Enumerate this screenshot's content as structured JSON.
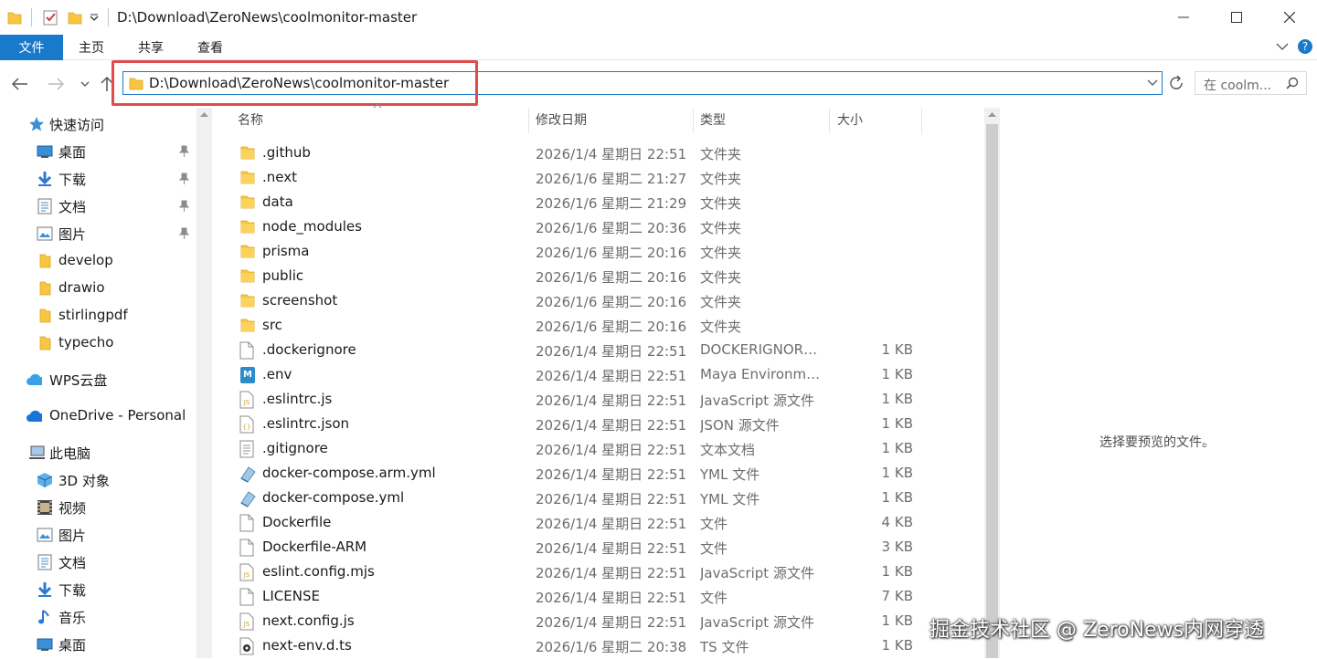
{
  "window": {
    "title": "D:\\Download\\ZeroNews\\coolmonitor-master",
    "minimize_label": "",
    "maximize_label": "",
    "close_label": ""
  },
  "ribbon": {
    "tabs": [
      "文件",
      "主页",
      "共享",
      "查看"
    ]
  },
  "address": {
    "path": "D:\\Download\\ZeroNews\\coolmonitor-master",
    "search_placeholder": "在 coolm..."
  },
  "sidebar": {
    "items": [
      {
        "label": "快速访问",
        "icon": "star-icon"
      },
      {
        "label": "桌面",
        "icon": "desktop-icon",
        "pinned": true
      },
      {
        "label": "下载",
        "icon": "download-icon",
        "pinned": true
      },
      {
        "label": "文档",
        "icon": "document-icon",
        "pinned": true
      },
      {
        "label": "图片",
        "icon": "picture-icon",
        "pinned": true
      },
      {
        "label": "develop",
        "icon": "folder-icon"
      },
      {
        "label": "drawio",
        "icon": "folder-icon"
      },
      {
        "label": "stirlingpdf",
        "icon": "folder-icon"
      },
      {
        "label": "typecho",
        "icon": "folder-icon"
      },
      {
        "label": "WPS云盘",
        "icon": "wps-cloud-icon"
      },
      {
        "label": "OneDrive - Personal",
        "icon": "onedrive-icon"
      },
      {
        "label": "此电脑",
        "icon": "computer-icon"
      },
      {
        "label": "3D 对象",
        "icon": "3d-objects-icon"
      },
      {
        "label": "视频",
        "icon": "video-icon"
      },
      {
        "label": "图片",
        "icon": "picture-icon"
      },
      {
        "label": "文档",
        "icon": "document-icon"
      },
      {
        "label": "下载",
        "icon": "download-icon"
      },
      {
        "label": "音乐",
        "icon": "music-icon"
      },
      {
        "label": "桌面",
        "icon": "desktop-icon"
      }
    ]
  },
  "columns": {
    "name": "名称",
    "date": "修改日期",
    "type": "类型",
    "size": "大小"
  },
  "files": [
    {
      "name": ".github",
      "date": "2026/1/4 星期日 22:51",
      "type": "文件夹",
      "size": "",
      "icon": "folder"
    },
    {
      "name": ".next",
      "date": "2026/1/6 星期二 21:27",
      "type": "文件夹",
      "size": "",
      "icon": "folder"
    },
    {
      "name": "data",
      "date": "2026/1/6 星期二 21:29",
      "type": "文件夹",
      "size": "",
      "icon": "folder"
    },
    {
      "name": "node_modules",
      "date": "2026/1/6 星期二 20:36",
      "type": "文件夹",
      "size": "",
      "icon": "folder"
    },
    {
      "name": "prisma",
      "date": "2026/1/6 星期二 20:16",
      "type": "文件夹",
      "size": "",
      "icon": "folder"
    },
    {
      "name": "public",
      "date": "2026/1/6 星期二 20:16",
      "type": "文件夹",
      "size": "",
      "icon": "folder"
    },
    {
      "name": "screenshot",
      "date": "2026/1/6 星期二 20:16",
      "type": "文件夹",
      "size": "",
      "icon": "folder"
    },
    {
      "name": "src",
      "date": "2026/1/6 星期二 20:16",
      "type": "文件夹",
      "size": "",
      "icon": "folder"
    },
    {
      "name": ".dockerignore",
      "date": "2026/1/4 星期日 22:51",
      "type": "DOCKERIGNORE...",
      "size": "1 KB",
      "icon": "file"
    },
    {
      "name": ".env",
      "date": "2026/1/4 星期日 22:51",
      "type": "Maya Environme...",
      "size": "1 KB",
      "icon": "maya"
    },
    {
      "name": ".eslintrc.js",
      "date": "2026/1/4 星期日 22:51",
      "type": "JavaScript 源文件",
      "size": "1 KB",
      "icon": "js"
    },
    {
      "name": ".eslintrc.json",
      "date": "2026/1/4 星期日 22:51",
      "type": "JSON 源文件",
      "size": "1 KB",
      "icon": "json"
    },
    {
      "name": ".gitignore",
      "date": "2026/1/4 星期日 22:51",
      "type": "文本文档",
      "size": "1 KB",
      "icon": "text"
    },
    {
      "name": "docker-compose.arm.yml",
      "date": "2026/1/4 星期日 22:51",
      "type": "YML 文件",
      "size": "1 KB",
      "icon": "yml"
    },
    {
      "name": "docker-compose.yml",
      "date": "2026/1/4 星期日 22:51",
      "type": "YML 文件",
      "size": "1 KB",
      "icon": "yml"
    },
    {
      "name": "Dockerfile",
      "date": "2026/1/4 星期日 22:51",
      "type": "文件",
      "size": "4 KB",
      "icon": "file"
    },
    {
      "name": "Dockerfile-ARM",
      "date": "2026/1/4 星期日 22:51",
      "type": "文件",
      "size": "3 KB",
      "icon": "file"
    },
    {
      "name": "eslint.config.mjs",
      "date": "2026/1/4 星期日 22:51",
      "type": "JavaScript 源文件",
      "size": "1 KB",
      "icon": "js"
    },
    {
      "name": "LICENSE",
      "date": "2026/1/4 星期日 22:51",
      "type": "文件",
      "size": "7 KB",
      "icon": "file"
    },
    {
      "name": "next.config.js",
      "date": "2026/1/4 星期日 22:51",
      "type": "JavaScript 源文件",
      "size": "1 KB",
      "icon": "js"
    },
    {
      "name": "next-env.d.ts",
      "date": "2026/1/6 星期二 20:38",
      "type": "TS 文件",
      "size": "1 KB",
      "icon": "ts"
    }
  ],
  "preview": {
    "empty_text": "选择要预览的文件。"
  },
  "watermark": "掘金技术社区 @ ZeroNews内网穿透",
  "colors": {
    "accent": "#1979ca",
    "highlight_border": "#e04b4b",
    "folder_yellow": "#f8c640"
  }
}
